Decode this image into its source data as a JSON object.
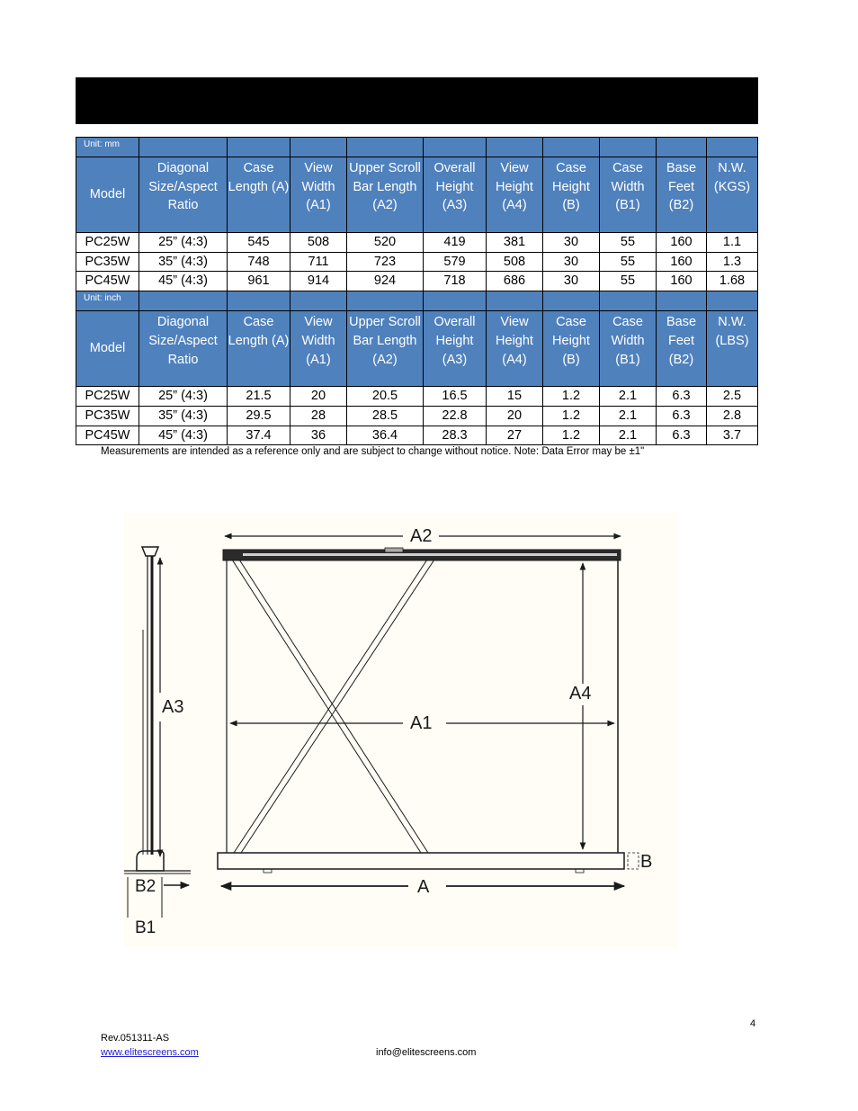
{
  "colors": {
    "header_fill": "#4f81bd",
    "header_text": "#ffffff",
    "title_bar": "#000000",
    "link": "#1f1fcf"
  },
  "tables": [
    {
      "unit_label": "Unit: mm",
      "headers": [
        "Model",
        "Diagonal Size/Aspect Ratio",
        "Case Length (A)",
        "View Width (A1)",
        "Upper Scroll Bar Length (A2)",
        "Overall Height (A3)",
        "View Height (A4)",
        "Case Height (B)",
        "Case Width (B1)",
        "Base Feet (B2)",
        "N.W. (KGS)"
      ],
      "rows": [
        [
          "PC25W",
          "25” (4:3)",
          "545",
          "508",
          "520",
          "419",
          "381",
          "30",
          "55",
          "160",
          "1.1"
        ],
        [
          "PC35W",
          "35” (4:3)",
          "748",
          "711",
          "723",
          "579",
          "508",
          "30",
          "55",
          "160",
          "1.3"
        ],
        [
          "PC45W",
          "45” (4:3)",
          "961",
          "914",
          "924",
          "718",
          "686",
          "30",
          "55",
          "160",
          "1.68"
        ]
      ]
    },
    {
      "unit_label": "Unit: inch",
      "headers": [
        "Model",
        "Diagonal Size/Aspect Ratio",
        "Case Length (A)",
        "View Width (A1)",
        "Upper Scroll Bar Length (A2)",
        "Overall Height (A3)",
        "View Height (A4)",
        "Case Height (B)",
        "Case Width (B1)",
        "Base Feet (B2)",
        "N.W. (LBS)"
      ],
      "rows": [
        [
          "PC25W",
          "25” (4:3)",
          "21.5",
          "20",
          "20.5",
          "16.5",
          "15",
          "1.2",
          "2.1",
          "6.3",
          "2.5"
        ],
        [
          "PC35W",
          "35” (4:3)",
          "29.5",
          "28",
          "28.5",
          "22.8",
          "20",
          "1.2",
          "2.1",
          "6.3",
          "2.8"
        ],
        [
          "PC45W",
          "45” (4:3)",
          "37.4",
          "36",
          "36.4",
          "28.3",
          "27",
          "1.2",
          "2.1",
          "6.3",
          "3.7"
        ]
      ]
    }
  ],
  "note": "Measurements are intended as a reference only and are subject to change without notice. Note: Data Error may be ±1\"",
  "diagram": {
    "labels": {
      "a": "A",
      "a1": "A1",
      "a2": "A2",
      "a3": "A3",
      "a4": "A4",
      "b": "B",
      "b1": "B1",
      "b2": "B2"
    }
  },
  "footer": {
    "page_number": "4",
    "revision": "Rev.051311-AS",
    "website": "www.elitescreens.com",
    "email": "info@elitescreens.com"
  }
}
